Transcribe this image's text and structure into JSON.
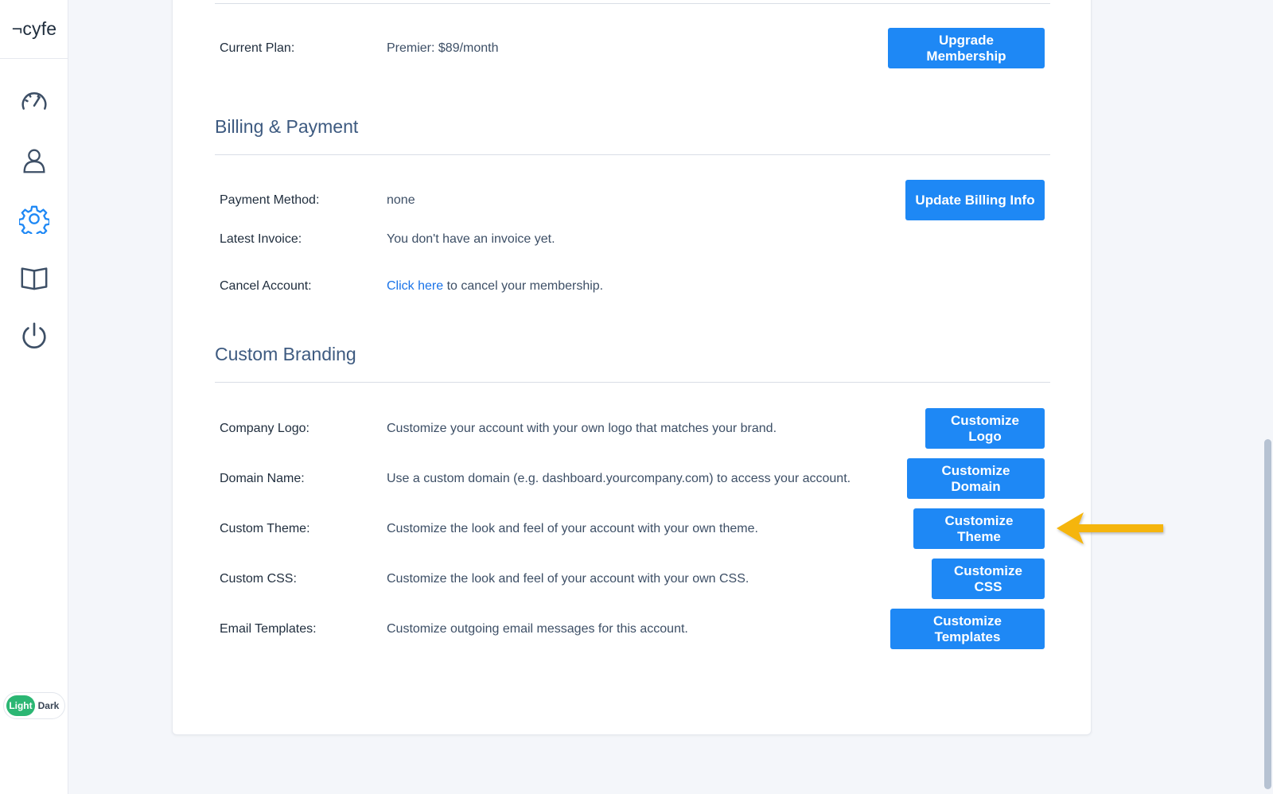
{
  "brand": {
    "logo_text": "¬cyfe"
  },
  "sidebar": {
    "icons": [
      {
        "name": "dashboard-icon",
        "color": "#3d4f66"
      },
      {
        "name": "user-icon",
        "color": "#3d4f66"
      },
      {
        "name": "gear-icon",
        "color": "#1e88f5"
      },
      {
        "name": "book-icon",
        "color": "#3d4f66"
      },
      {
        "name": "power-icon",
        "color": "#3d4f66"
      }
    ],
    "theme_toggle": {
      "light_label": "Light",
      "dark_label": "Dark",
      "active": "Light"
    }
  },
  "membership": {
    "current_plan_label": "Current Plan:",
    "current_plan_value": "Premier: $89/month",
    "upgrade_button": "Upgrade Membership"
  },
  "billing": {
    "title": "Billing & Payment",
    "payment_method_label": "Payment Method:",
    "payment_method_value": "none",
    "update_button": "Update Billing Info",
    "latest_invoice_label": "Latest Invoice:",
    "latest_invoice_value": "You don't have an invoice yet.",
    "cancel_label": "Cancel Account:",
    "cancel_link": "Click here",
    "cancel_text": " to cancel your membership."
  },
  "branding": {
    "title": "Custom Branding",
    "rows": [
      {
        "label": "Company Logo:",
        "desc": "Customize your account with your own logo that matches your brand.",
        "button": "Customize Logo"
      },
      {
        "label": "Domain Name:",
        "desc": "Use a custom domain (e.g. dashboard.yourcompany.com) to access your account.",
        "button": "Customize Domain"
      },
      {
        "label": "Custom Theme:",
        "desc": "Customize the look and feel of your account with your own theme.",
        "button": "Customize Theme"
      },
      {
        "label": "Custom CSS:",
        "desc": "Customize the look and feel of your account with your own CSS.",
        "button": "Customize CSS"
      },
      {
        "label": "Email Templates:",
        "desc": "Customize outgoing email messages for this account.",
        "button": "Customize Templates"
      }
    ]
  },
  "colors": {
    "accent": "#1e88f5",
    "toggle_active": "#2bb673",
    "arrow": "#f5b50f"
  }
}
